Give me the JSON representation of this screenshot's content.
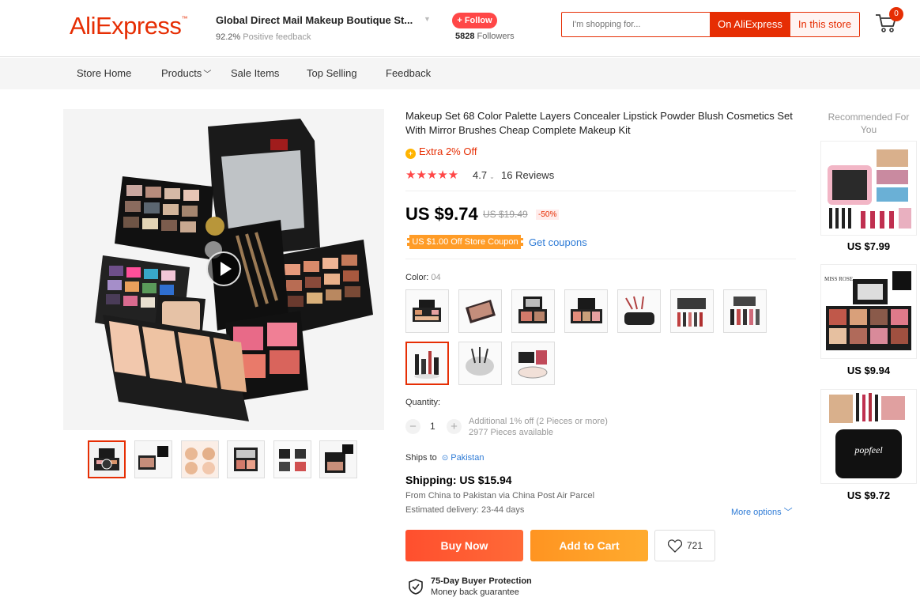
{
  "header": {
    "logo": "AliExpress",
    "logo_tm": "™",
    "store_name": "Global Direct Mail Makeup Boutique St...",
    "feedback_percent": "92.2%",
    "feedback_label": "Positive feedback",
    "follow_label": "+ Follow",
    "followers_count": "5828",
    "followers_label": "Followers",
    "search_placeholder": "I'm shopping for...",
    "search_on_ae": "On AliExpress",
    "search_in_store": "In this store",
    "cart_count": "0"
  },
  "nav": {
    "items": [
      "Store Home",
      "Products",
      "Sale Items",
      "Top Selling",
      "Feedback"
    ]
  },
  "product": {
    "title": "Makeup Set 68 Color Palette Layers Concealer Lipstick Powder Blush Cosmetics Set With Mirror Brushes Cheap Complete Makeup Kit",
    "extra_off": "Extra 2% Off",
    "stars": "★★★★★",
    "rating": "4.7",
    "reviews": "16 Reviews",
    "price": "US $9.74",
    "old_price": "US $19.49",
    "discount": "-50%",
    "coupon": "US $1.00 Off Store Coupon",
    "get_coupons": "Get coupons",
    "color_label": "Color:",
    "color_value": "04",
    "quantity_label": "Quantity:",
    "quantity_value": "1",
    "qty_minus": "−",
    "qty_plus": "+",
    "qty_discount": "Additional 1% off (2 Pieces or more)",
    "qty_available": "2977 Pieces available",
    "ships_to_label": "Ships to",
    "ships_to_value": "Pakistan",
    "shipping": "Shipping: US $15.94",
    "ship_from": "From China to Pakistan via China Post Air Parcel",
    "ship_estimated": "Estimated delivery: 23-44 days",
    "more_options": "More options",
    "buy_now": "Buy Now",
    "add_to_cart": "Add to Cart",
    "wishlist_count": "721",
    "protection_title": "75-Day Buyer Protection",
    "protection_sub": "Money back guarantee"
  },
  "recommended": {
    "title": "Recommended For You",
    "items": [
      {
        "price": "US $7.99"
      },
      {
        "price": "US $9.94",
        "brand": "MISS ROSE"
      },
      {
        "price": "US $9.72",
        "brand": "popfeel"
      }
    ]
  },
  "colors": {
    "brand_red": "#e62e04",
    "buy_now": "#ff4f2e",
    "add_to_cart": "#ff9421",
    "link_blue": "#2e7bd6",
    "star_red": "#ff4747"
  }
}
